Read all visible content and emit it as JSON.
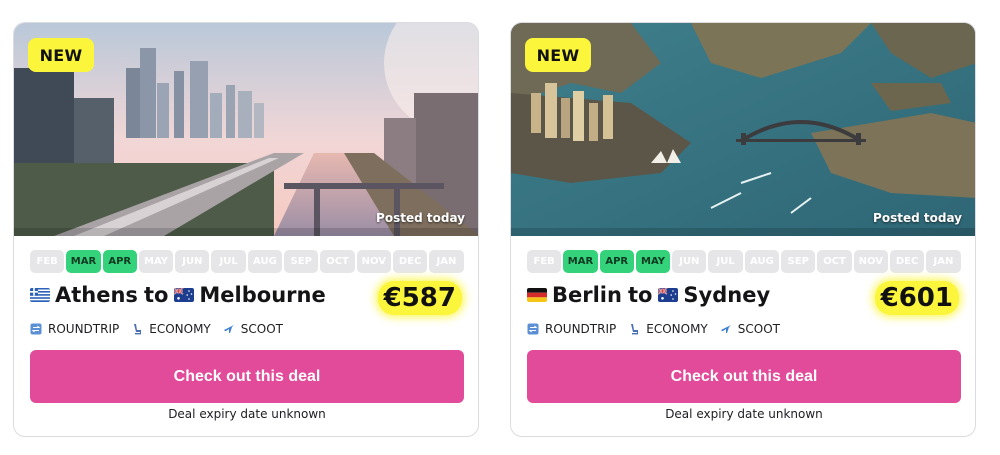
{
  "months": [
    "FEB",
    "MAR",
    "APR",
    "MAY",
    "JUN",
    "JUL",
    "AUG",
    "SEP",
    "OCT",
    "NOV",
    "DEC",
    "JAN"
  ],
  "deals": [
    {
      "badge": "NEW",
      "posted": "Posted today",
      "active_months": [
        "MAR",
        "APR"
      ],
      "origin": "Athens",
      "connector": "to",
      "destination": "Melbourne",
      "origin_flag": "greece-flag-icon",
      "destination_flag": "australia-flag-icon",
      "price": "€587",
      "trip_type": "ROUNDTRIP",
      "cabin": "ECONOMY",
      "airline": "SCOOT",
      "cta_label": "Check out this deal",
      "expiry": "Deal expiry date unknown",
      "photo": "melbourne-city-photo"
    },
    {
      "badge": "NEW",
      "posted": "Posted today",
      "active_months": [
        "MAR",
        "APR",
        "MAY"
      ],
      "origin": "Berlin",
      "connector": "to",
      "destination": "Sydney",
      "origin_flag": "germany-flag-icon",
      "destination_flag": "australia-flag-icon",
      "price": "€601",
      "trip_type": "ROUNDTRIP",
      "cabin": "ECONOMY",
      "airline": "SCOOT",
      "cta_label": "Check out this deal",
      "expiry": "Deal expiry date unknown",
      "photo": "sydney-harbour-photo"
    }
  ],
  "colors": {
    "badge_yellow": "#fbf53b",
    "month_active": "#33d27b",
    "month_inactive": "#e6e6e9",
    "cta_pink": "#e24a9a"
  }
}
